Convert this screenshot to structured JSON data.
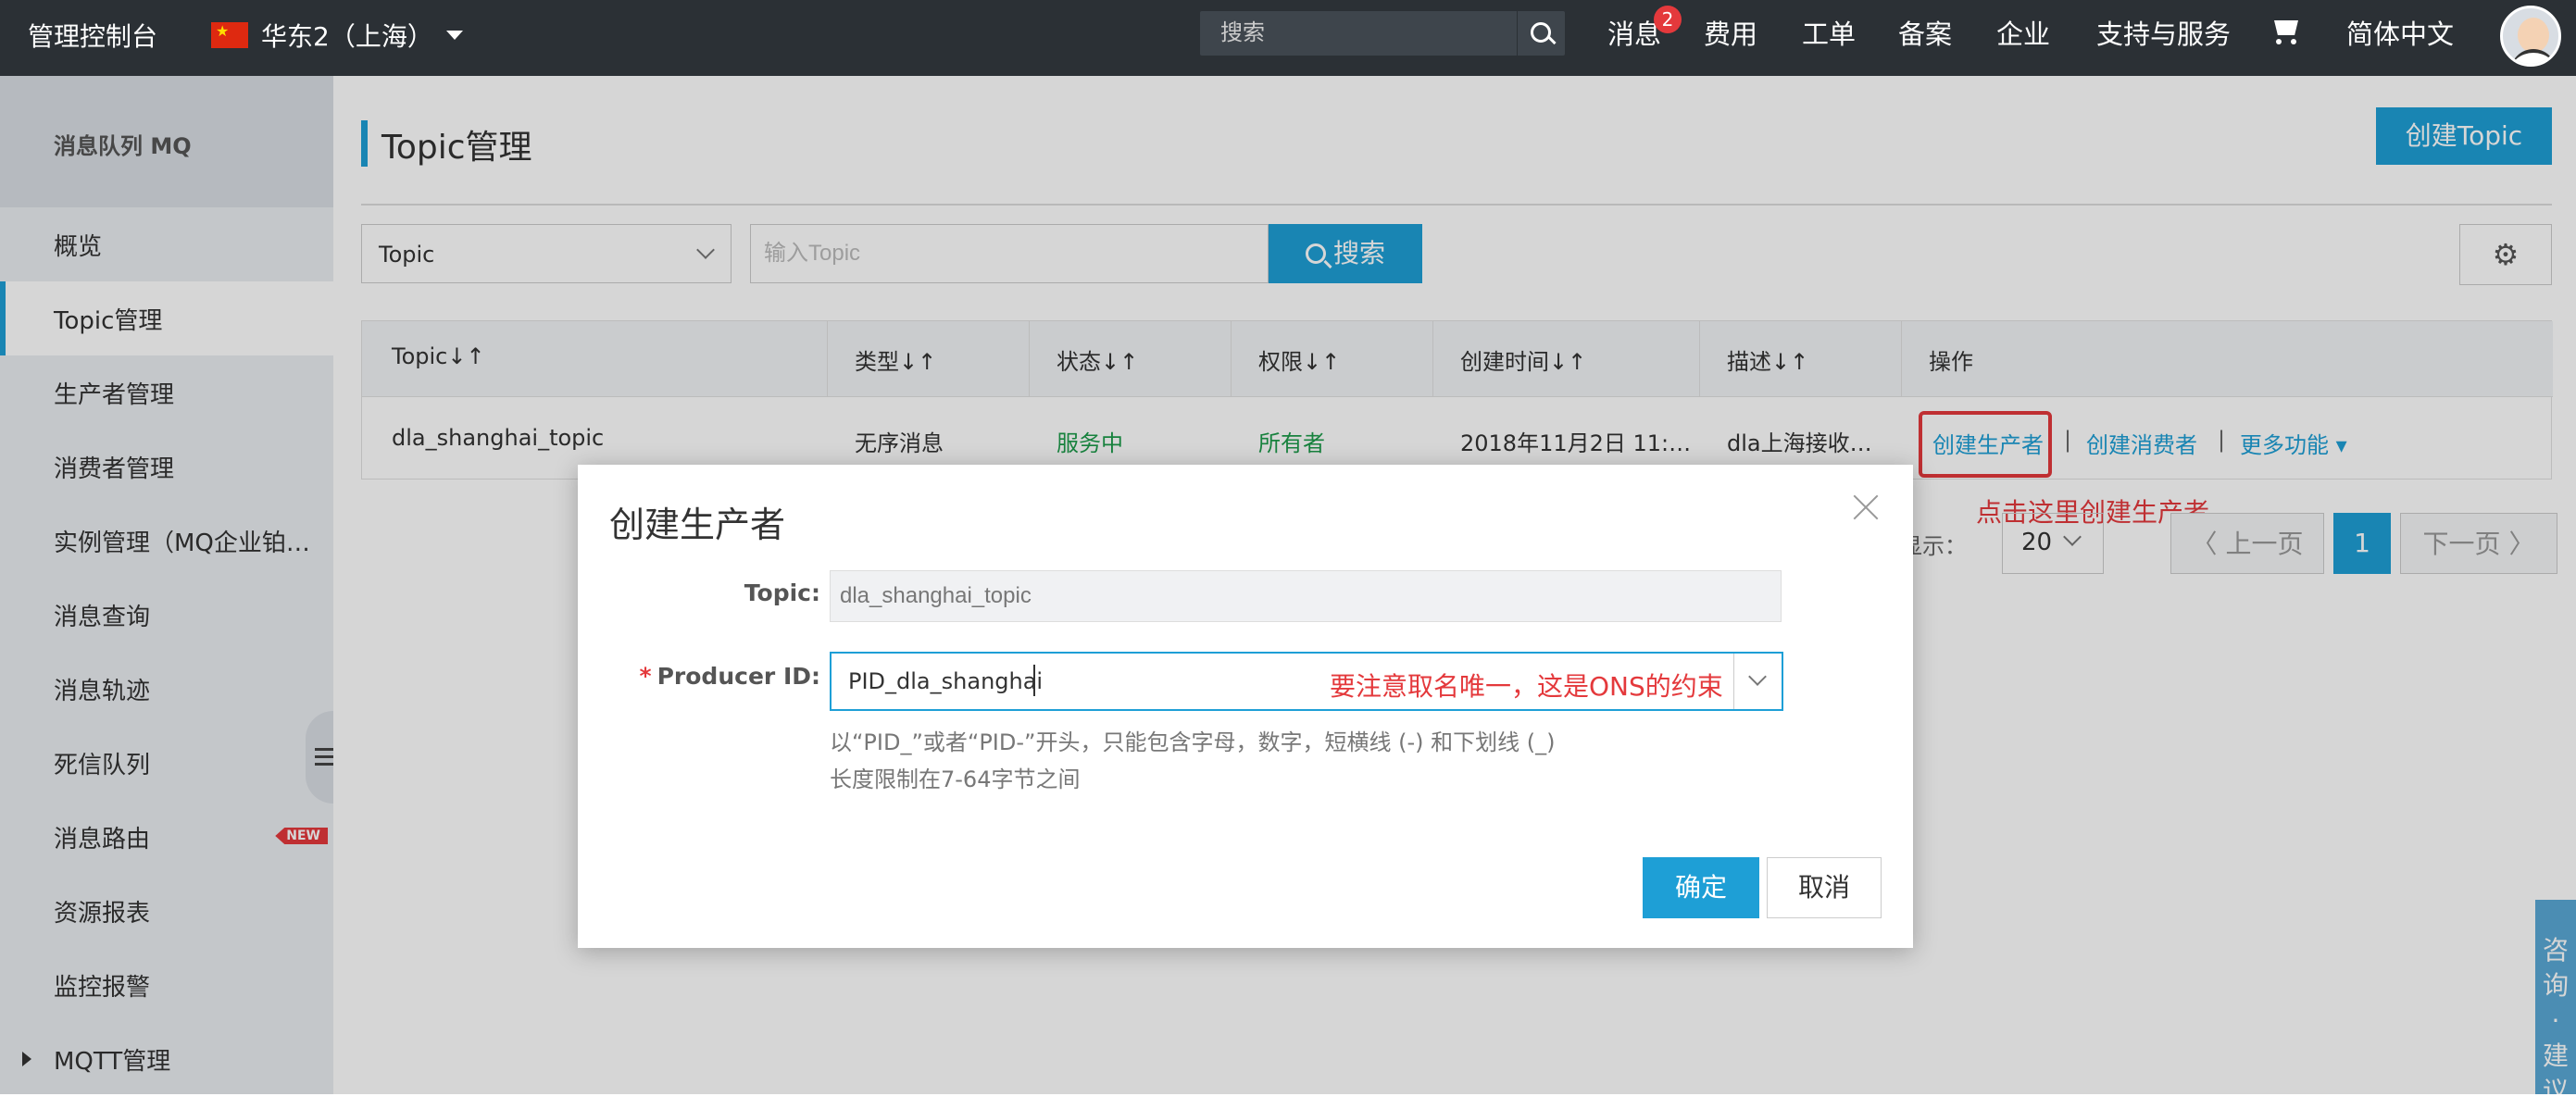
{
  "topbar": {
    "brand": "管理控制台",
    "region": "华东2（上海）",
    "search_placeholder": "搜索",
    "nav": [
      "消息",
      "费用",
      "工单",
      "备案",
      "企业",
      "支持与服务",
      "简体中文"
    ],
    "message_badge": "2"
  },
  "sidebar": {
    "header": "消息队列 MQ",
    "items": [
      "概览",
      "Topic管理",
      "生产者管理",
      "消费者管理",
      "实例管理（MQ企业铂…",
      "消息查询",
      "消息轨迹",
      "死信队列",
      "消息路由",
      "资源报表",
      "监控报警",
      "MQTT管理"
    ],
    "active_index": 1,
    "new_tag": "NEW"
  },
  "main": {
    "title": "Topic管理",
    "create_button": "创建Topic",
    "filter_select": "Topic",
    "filter_placeholder": "输入Topic",
    "search_button": "搜索",
    "table": {
      "headers": [
        "Topic",
        "类型",
        "状态",
        "权限",
        "创建时间",
        "描述",
        "操作"
      ],
      "sort_glyph": "↓↑",
      "row": {
        "topic": "dla_shanghai_topic",
        "type": "无序消息",
        "status": "服务中",
        "permission": "所有者",
        "created": "2018年11月2日 11:…",
        "description": "dla上海接收…",
        "actions": [
          "创建生产者",
          "创建消费者",
          "更多功能"
        ],
        "separator": "|"
      }
    },
    "annotation": "点击这里创建生产者",
    "pager": {
      "page_size_label": "每页显示：",
      "page_size": "20",
      "prev": "上一页",
      "current": "1",
      "next": "下一页"
    },
    "feedback": [
      "咨",
      "询",
      "·",
      "建",
      "议"
    ]
  },
  "modal": {
    "title": "创建生产者",
    "topic_label": "Topic:",
    "topic_value": "dla_shanghai_topic",
    "required_mark": "*",
    "producer_label": "Producer ID:",
    "producer_value": "PID_dla_shanghai",
    "producer_annotation": "要注意取名唯一，这是ONS的约束",
    "hint1": "以“PID_”或者“PID-”开头，只能包含字母，数字，短横线 (-) 和下划线 (_)",
    "hint2": "长度限制在7-64字节之间",
    "ok": "确定",
    "cancel": "取消"
  },
  "colors": {
    "accent": "#1e9fd6",
    "topbar": "#2b3035",
    "danger": "#e4393c",
    "success": "#1d9b4b"
  }
}
